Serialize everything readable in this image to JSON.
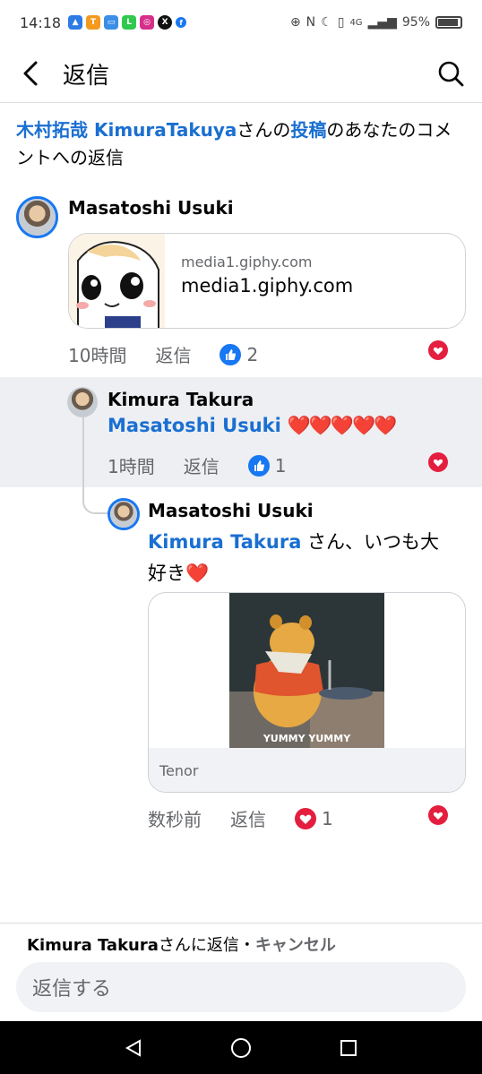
{
  "status": {
    "time": "14:18",
    "battery": "95%",
    "network": "4G"
  },
  "header": {
    "title": "返信"
  },
  "context": {
    "author": "木村拓哉 KimuraTakuya",
    "text1": "さんの",
    "post_link": "投稿",
    "text2": "のあなたのコメントへの返信"
  },
  "comments": [
    {
      "author": "Masatoshi Usuki",
      "link_card": {
        "domain": "media1.giphy.com",
        "title": "media1.giphy.com"
      },
      "time": "10時間",
      "reply_label": "返信",
      "reaction_count": "2"
    },
    {
      "author": "Kimura Takura",
      "mention": "Masatoshi Usuki",
      "text": "❤️❤️❤️❤️❤️",
      "time": "1時間",
      "reply_label": "返信",
      "reaction_count": "1"
    },
    {
      "author": "Masatoshi Usuki",
      "mention": "Kimura Takura",
      "text": " さん、いつも大好き❤️",
      "gif": {
        "caption": "YUMMY YUMMY",
        "source": "Tenor"
      },
      "time": "数秒前",
      "reply_label": "返信",
      "reaction_count": "1"
    }
  ],
  "reply_bar": {
    "target": "Kimura Takura",
    "suffix": "さんに返信・",
    "cancel": "キャンセル",
    "placeholder": "返信する"
  },
  "colors": {
    "link": "#1a6fd1",
    "like": "#1877f2",
    "heart": "#e41e3f",
    "highlight": "#edeff2"
  }
}
